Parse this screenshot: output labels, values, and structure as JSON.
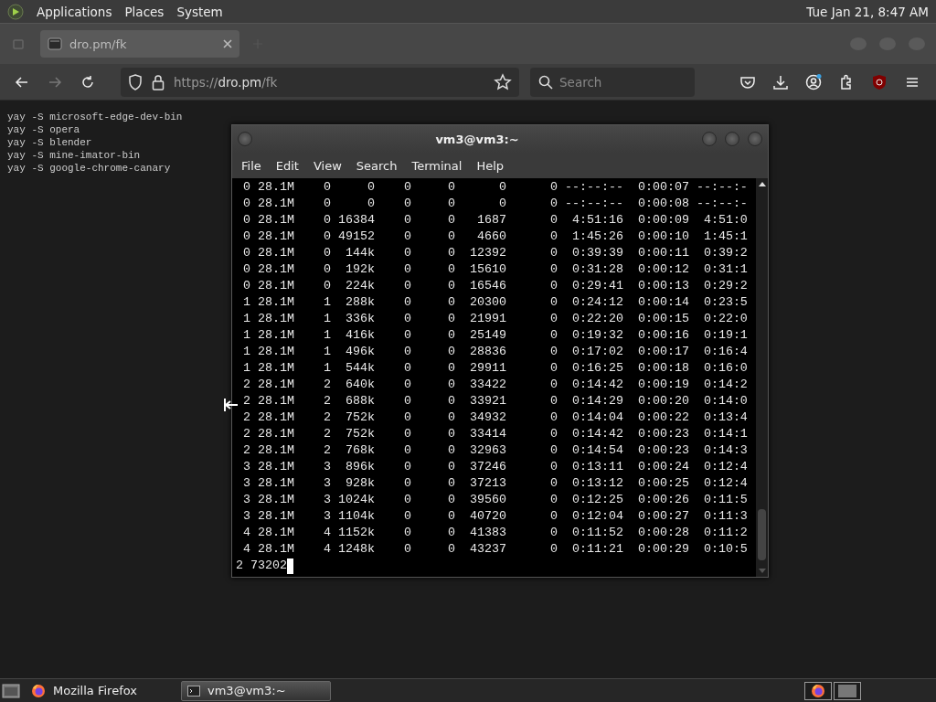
{
  "top_panel": {
    "menus": [
      "Applications",
      "Places",
      "System"
    ],
    "clock": "Tue Jan 21, 8:47 AM"
  },
  "browser": {
    "tabs": [
      {
        "title": "dro.pm/fk",
        "selected": true
      }
    ],
    "nav": {
      "forward_disabled": true
    },
    "url": {
      "scheme": "https://",
      "host": "dro.pm",
      "path": "/fk"
    },
    "search": {
      "placeholder": "Search"
    },
    "page_lines": [
      "yay -S microsoft-edge-dev-bin",
      "yay -S opera",
      "yay -S blender",
      "yay -S mine-imator-bin",
      "yay -S google-chrome-canary"
    ]
  },
  "terminal": {
    "title": "vm3@vm3:~",
    "menus": [
      "File",
      "Edit",
      "View",
      "Search",
      "Terminal",
      "Help"
    ],
    "lines": [
      " 0 28.1M    0     0    0     0      0      0 --:--:--  0:00:07 --:--:-",
      " 0 28.1M    0     0    0     0      0      0 --:--:--  0:00:08 --:--:-",
      " 0 28.1M    0 16384    0     0   1687      0  4:51:16  0:00:09  4:51:0",
      " 0 28.1M    0 49152    0     0   4660      0  1:45:26  0:00:10  1:45:1",
      " 0 28.1M    0  144k    0     0  12392      0  0:39:39  0:00:11  0:39:2",
      " 0 28.1M    0  192k    0     0  15610      0  0:31:28  0:00:12  0:31:1",
      " 0 28.1M    0  224k    0     0  16546      0  0:29:41  0:00:13  0:29:2",
      " 1 28.1M    1  288k    0     0  20300      0  0:24:12  0:00:14  0:23:5",
      " 1 28.1M    1  336k    0     0  21991      0  0:22:20  0:00:15  0:22:0",
      " 1 28.1M    1  416k    0     0  25149      0  0:19:32  0:00:16  0:19:1",
      " 1 28.1M    1  496k    0     0  28836      0  0:17:02  0:00:17  0:16:4",
      " 1 28.1M    1  544k    0     0  29911      0  0:16:25  0:00:18  0:16:0",
      " 2 28.1M    2  640k    0     0  33422      0  0:14:42  0:00:19  0:14:2",
      " 2 28.1M    2  688k    0     0  33921      0  0:14:29  0:00:20  0:14:0",
      " 2 28.1M    2  752k    0     0  34932      0  0:14:04  0:00:22  0:13:4",
      " 2 28.1M    2  752k    0     0  33414      0  0:14:42  0:00:23  0:14:1",
      " 2 28.1M    2  768k    0     0  32963      0  0:14:54  0:00:23  0:14:3",
      " 3 28.1M    3  896k    0     0  37246      0  0:13:11  0:00:24  0:12:4",
      " 3 28.1M    3  928k    0     0  37213      0  0:13:12  0:00:25  0:12:4",
      " 3 28.1M    3 1024k    0     0  39560      0  0:12:25  0:00:26  0:11:5",
      " 3 28.1M    3 1104k    0     0  40720      0  0:12:04  0:00:27  0:11:3",
      " 4 28.1M    4 1152k    0     0  41383      0  0:11:52  0:00:28  0:11:2",
      " 4 28.1M    4 1248k    0     0  43237      0  0:11:21  0:00:29  0:10:5"
    ],
    "prompt": "2 73202"
  },
  "taskbar": {
    "tasks": [
      {
        "label": "Mozilla Firefox",
        "kind": "browser",
        "selected": false
      },
      {
        "label": "vm3@vm3:~",
        "kind": "terminal",
        "selected": true
      }
    ]
  }
}
